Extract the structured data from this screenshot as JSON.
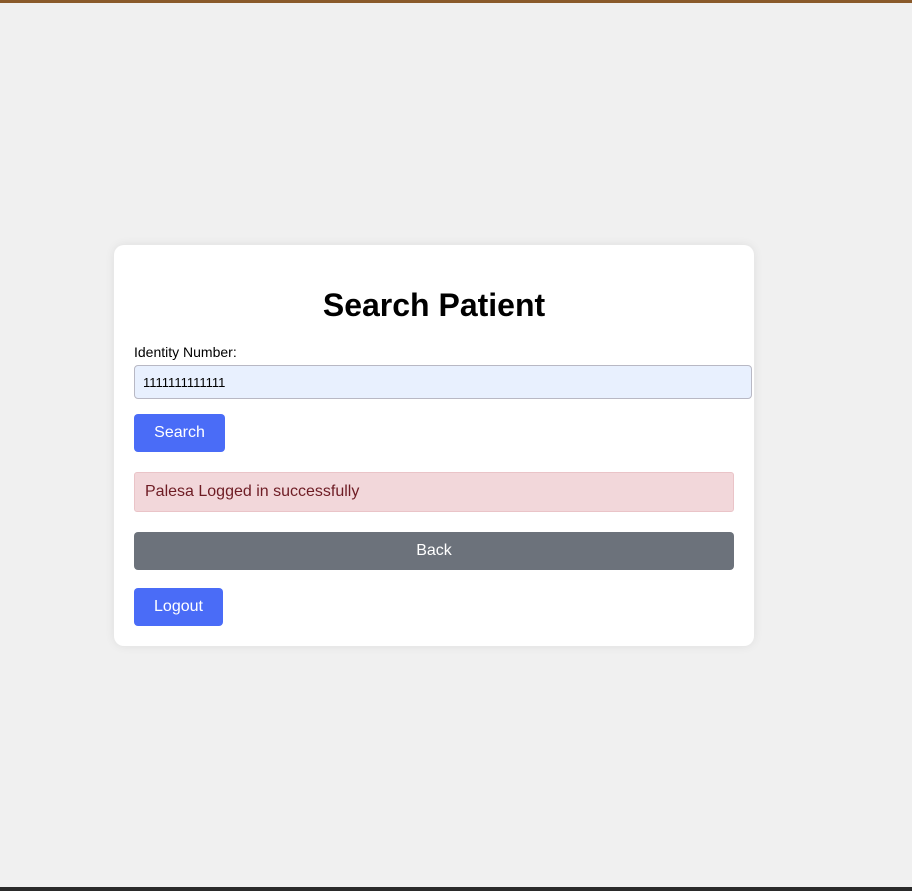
{
  "page": {
    "title": "Search Patient"
  },
  "form": {
    "identity_label": "Identity Number:",
    "identity_value": "1111111111111",
    "search_label": "Search"
  },
  "alert": {
    "message": "Palesa Logged in successfully"
  },
  "actions": {
    "back_label": "Back",
    "logout_label": "Logout"
  },
  "colors": {
    "primary": "#4a6cf7",
    "secondary": "#6c727b",
    "alert_bg": "#f2d7da",
    "alert_text": "#6e1c24",
    "input_bg": "#e8f0fe"
  }
}
